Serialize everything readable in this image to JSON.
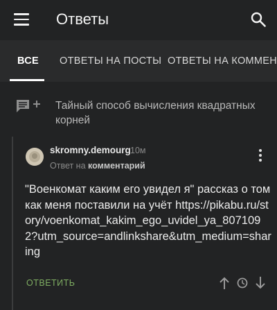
{
  "appbar": {
    "title": "Ответы",
    "menu_icon": "menu-icon",
    "search_icon": "search-icon"
  },
  "tabs": [
    {
      "label": "ВСЕ",
      "active": true
    },
    {
      "label": "ОТВЕТЫ НА ПОСТЫ",
      "active": false
    },
    {
      "label": "ОТВЕТЫ НА КОММЕН",
      "active": false
    }
  ],
  "post": {
    "icon": "comment-add-icon",
    "title": "Тайный способ вычисления квадратных корней"
  },
  "comment": {
    "author": "skromny.demourg",
    "time": "10м",
    "reply_prefix": "Ответ на",
    "reply_target": "комментарий",
    "text": "\"Военкомат каким его увидел я\" рассказ о том как меня поставили на учёт https://pikabu.ru/story/voenkomat_kakim_ego_uvidel_ya_8071092?utm_source=andlinkshare&utm_medium=sharing",
    "reply_button": "ОТВЕТИТЬ"
  },
  "colors": {
    "background": "#222324",
    "tabs_background": "#2a2b2c",
    "reply_accent": "#7fae62"
  }
}
